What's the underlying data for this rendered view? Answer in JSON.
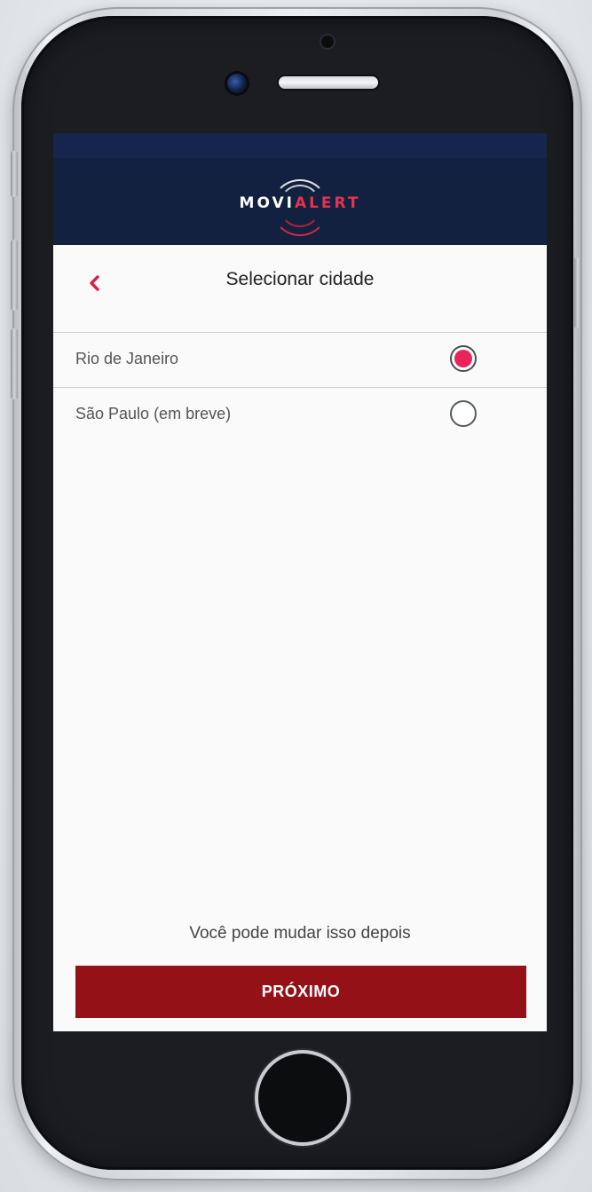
{
  "app": {
    "logo": {
      "part1": "MOVI",
      "part2": "ALERT"
    }
  },
  "header": {
    "title": "Selecionar cidade",
    "back_icon": "chevron-left-icon"
  },
  "cities": [
    {
      "label": "Rio de Janeiro",
      "selected": true
    },
    {
      "label": "São Paulo (em breve)",
      "selected": false
    }
  ],
  "footer": {
    "hint": "Você pode mudar isso depois",
    "next_label": "PRÓXIMO"
  },
  "colors": {
    "header_bg": "#11213f",
    "accent": "#e9245a",
    "button_bg": "#941118"
  }
}
